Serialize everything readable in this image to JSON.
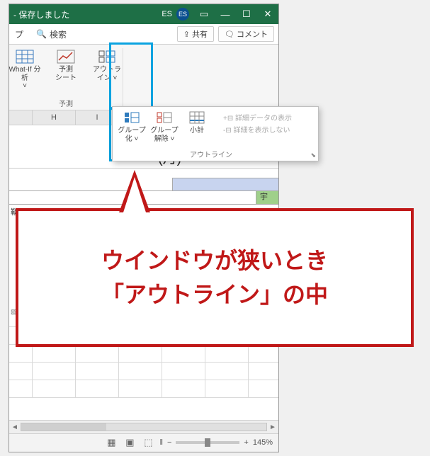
{
  "titlebar": {
    "savedText": "- 保存しました",
    "userInitials": "ES",
    "avatarInitials": "ES"
  },
  "ribbonTabs": {
    "tab1": "プ",
    "search": "検索",
    "share": "⇪ 共有",
    "comment": "🗨 コメント"
  },
  "ribbon": {
    "whatIf": "What-If 分析\n˅",
    "forecastSheet": "予測\nシート",
    "outline": "アウトラ\nイン ˅",
    "forecastGroup": "予測"
  },
  "outlinePanel": {
    "group": "グループ\n化 ˅",
    "ungroup": "グループ\n解除 ˅",
    "subtotal": "小計",
    "showDetail": "+⊟ 詳細データの表示",
    "hideDetail": "-⊟ 詳細を表示しない",
    "label": "アウトライン",
    "launcher": "⬊"
  },
  "columns": {
    "h": "H",
    "i": "I"
  },
  "sheet": {
    "dayLabel": "(月)",
    "kanji": "宇",
    "leftEdge": "鞘"
  },
  "callout": {
    "line1": "ウインドウが狭いとき",
    "line2": "「アウトライン」の中"
  },
  "statusbar": {
    "zoom": "145%",
    "plus": "+",
    "minus": "−",
    "sep": "‖"
  }
}
